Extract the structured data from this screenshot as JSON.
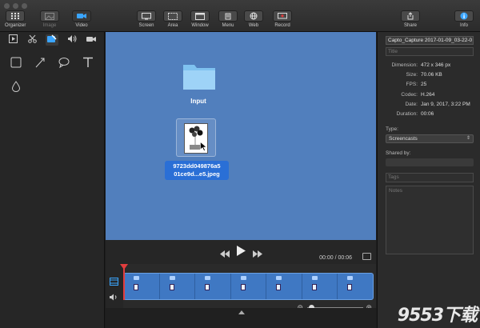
{
  "toolbar": {
    "organizer": "Organizer",
    "image": "Image",
    "video": "Video",
    "screen": "Screen",
    "area": "Area",
    "window": "Window",
    "menu": "Menu",
    "web": "Web",
    "record": "Record",
    "share": "Share",
    "info": "Info"
  },
  "canvas": {
    "folder_label": "Input",
    "file_label_line1": "9723dd049876a5",
    "file_label_line2": "01ce9d...e5.jpeg"
  },
  "playback": {
    "timecode": "00:00 / 00:06"
  },
  "info": {
    "filename": "Capto_Capture 2017-01-09_03-22-0",
    "title_placeholder": "Title",
    "meta": [
      {
        "key": "Dimension:",
        "value": "472 x 346 px"
      },
      {
        "key": "Size:",
        "value": "70.06 KB"
      },
      {
        "key": "FPS:",
        "value": "25"
      },
      {
        "key": "Codec:",
        "value": "H.264"
      },
      {
        "key": "Date:",
        "value": "Jan 9, 2017, 3:22 PM"
      },
      {
        "key": "Duration:",
        "value": "00:06"
      }
    ],
    "type_label": "Type:",
    "type_value": "Screencasts",
    "shared_label": "Shared by:",
    "tags_placeholder": "Tags",
    "notes_placeholder": "Notes"
  },
  "watermark": "9553下载",
  "colors": {
    "canvas_bg": "#517fbd",
    "accent": "#2a6fd6",
    "playhead": "#e23d3d"
  }
}
